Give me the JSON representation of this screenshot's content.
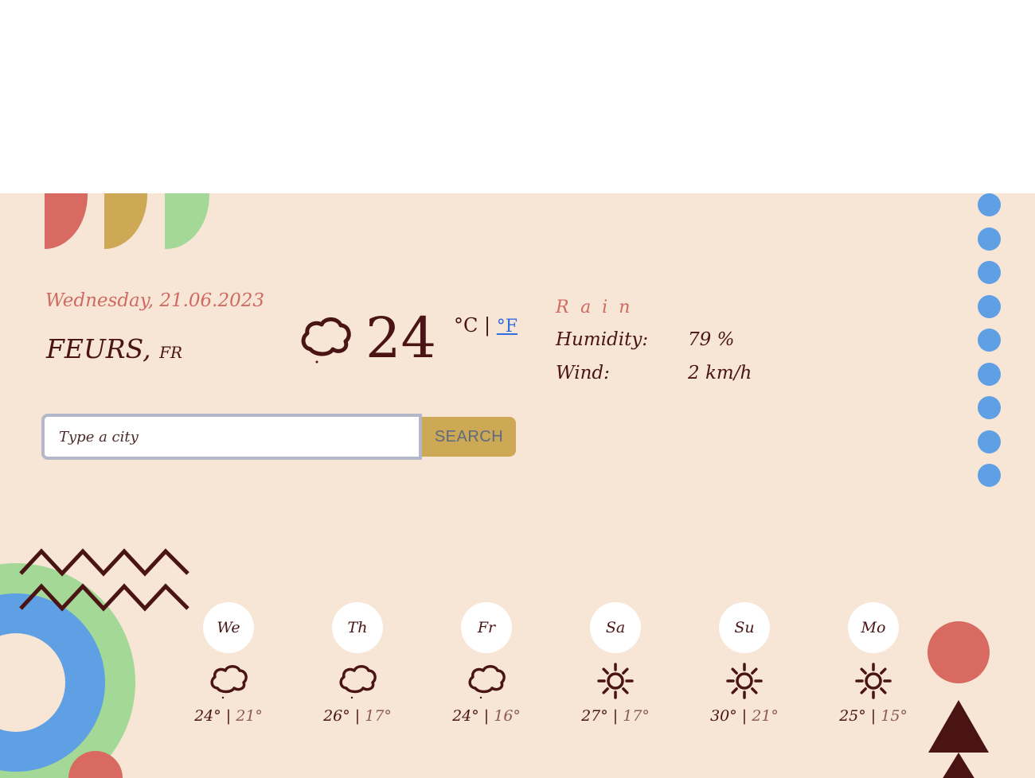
{
  "header": {
    "date": "Wednesday, 21.06.2023",
    "city": "FEURS,",
    "country": "FR"
  },
  "current": {
    "icon": "cloud-icon",
    "temperature": "24",
    "unit_celsius": "°C",
    "unit_sep": "|",
    "unit_fahrenheit": "°F",
    "condition": "Rain",
    "humidity_label": "Humidity:",
    "humidity_value": "79 %",
    "wind_label": "Wind:",
    "wind_value": "2 km/h"
  },
  "search": {
    "placeholder": "Type a city",
    "button_label": "SEARCH"
  },
  "forecast": [
    {
      "day": "We",
      "icon": "cloud-icon",
      "high": "24°",
      "low": "21°"
    },
    {
      "day": "Th",
      "icon": "cloud-icon",
      "high": "26°",
      "low": "17°"
    },
    {
      "day": "Fr",
      "icon": "cloud-icon",
      "high": "24°",
      "low": "16°"
    },
    {
      "day": "Sa",
      "icon": "sun-icon",
      "high": "27°",
      "low": "17°"
    },
    {
      "day": "Su",
      "icon": "sun-icon",
      "high": "30°",
      "low": "21°"
    },
    {
      "day": "Mo",
      "icon": "sun-icon",
      "high": "25°",
      "low": "15°"
    }
  ],
  "colors": {
    "background": "#f7e6d6",
    "accent_red": "#d86a62",
    "accent_gold": "#cda855",
    "accent_green": "#a3d896",
    "accent_blue": "#5f9fe3",
    "text_dark": "#4a1414"
  }
}
